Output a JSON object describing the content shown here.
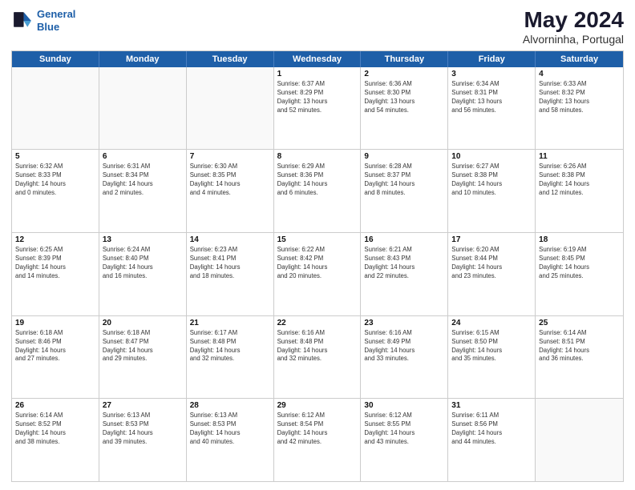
{
  "header": {
    "logo_line1": "General",
    "logo_line2": "Blue",
    "title": "May 2024",
    "subtitle": "Alvorninha, Portugal"
  },
  "calendar": {
    "days_of_week": [
      "Sunday",
      "Monday",
      "Tuesday",
      "Wednesday",
      "Thursday",
      "Friday",
      "Saturday"
    ],
    "rows": [
      [
        {
          "day": "",
          "info": ""
        },
        {
          "day": "",
          "info": ""
        },
        {
          "day": "",
          "info": ""
        },
        {
          "day": "1",
          "info": "Sunrise: 6:37 AM\nSunset: 8:29 PM\nDaylight: 13 hours\nand 52 minutes."
        },
        {
          "day": "2",
          "info": "Sunrise: 6:36 AM\nSunset: 8:30 PM\nDaylight: 13 hours\nand 54 minutes."
        },
        {
          "day": "3",
          "info": "Sunrise: 6:34 AM\nSunset: 8:31 PM\nDaylight: 13 hours\nand 56 minutes."
        },
        {
          "day": "4",
          "info": "Sunrise: 6:33 AM\nSunset: 8:32 PM\nDaylight: 13 hours\nand 58 minutes."
        }
      ],
      [
        {
          "day": "5",
          "info": "Sunrise: 6:32 AM\nSunset: 8:33 PM\nDaylight: 14 hours\nand 0 minutes."
        },
        {
          "day": "6",
          "info": "Sunrise: 6:31 AM\nSunset: 8:34 PM\nDaylight: 14 hours\nand 2 minutes."
        },
        {
          "day": "7",
          "info": "Sunrise: 6:30 AM\nSunset: 8:35 PM\nDaylight: 14 hours\nand 4 minutes."
        },
        {
          "day": "8",
          "info": "Sunrise: 6:29 AM\nSunset: 8:36 PM\nDaylight: 14 hours\nand 6 minutes."
        },
        {
          "day": "9",
          "info": "Sunrise: 6:28 AM\nSunset: 8:37 PM\nDaylight: 14 hours\nand 8 minutes."
        },
        {
          "day": "10",
          "info": "Sunrise: 6:27 AM\nSunset: 8:38 PM\nDaylight: 14 hours\nand 10 minutes."
        },
        {
          "day": "11",
          "info": "Sunrise: 6:26 AM\nSunset: 8:38 PM\nDaylight: 14 hours\nand 12 minutes."
        }
      ],
      [
        {
          "day": "12",
          "info": "Sunrise: 6:25 AM\nSunset: 8:39 PM\nDaylight: 14 hours\nand 14 minutes."
        },
        {
          "day": "13",
          "info": "Sunrise: 6:24 AM\nSunset: 8:40 PM\nDaylight: 14 hours\nand 16 minutes."
        },
        {
          "day": "14",
          "info": "Sunrise: 6:23 AM\nSunset: 8:41 PM\nDaylight: 14 hours\nand 18 minutes."
        },
        {
          "day": "15",
          "info": "Sunrise: 6:22 AM\nSunset: 8:42 PM\nDaylight: 14 hours\nand 20 minutes."
        },
        {
          "day": "16",
          "info": "Sunrise: 6:21 AM\nSunset: 8:43 PM\nDaylight: 14 hours\nand 22 minutes."
        },
        {
          "day": "17",
          "info": "Sunrise: 6:20 AM\nSunset: 8:44 PM\nDaylight: 14 hours\nand 23 minutes."
        },
        {
          "day": "18",
          "info": "Sunrise: 6:19 AM\nSunset: 8:45 PM\nDaylight: 14 hours\nand 25 minutes."
        }
      ],
      [
        {
          "day": "19",
          "info": "Sunrise: 6:18 AM\nSunset: 8:46 PM\nDaylight: 14 hours\nand 27 minutes."
        },
        {
          "day": "20",
          "info": "Sunrise: 6:18 AM\nSunset: 8:47 PM\nDaylight: 14 hours\nand 29 minutes."
        },
        {
          "day": "21",
          "info": "Sunrise: 6:17 AM\nSunset: 8:48 PM\nDaylight: 14 hours\nand 32 minutes."
        },
        {
          "day": "22",
          "info": "Sunrise: 6:16 AM\nSunset: 8:48 PM\nDaylight: 14 hours\nand 32 minutes."
        },
        {
          "day": "23",
          "info": "Sunrise: 6:16 AM\nSunset: 8:49 PM\nDaylight: 14 hours\nand 33 minutes."
        },
        {
          "day": "24",
          "info": "Sunrise: 6:15 AM\nSunset: 8:50 PM\nDaylight: 14 hours\nand 35 minutes."
        },
        {
          "day": "25",
          "info": "Sunrise: 6:14 AM\nSunset: 8:51 PM\nDaylight: 14 hours\nand 36 minutes."
        }
      ],
      [
        {
          "day": "26",
          "info": "Sunrise: 6:14 AM\nSunset: 8:52 PM\nDaylight: 14 hours\nand 38 minutes."
        },
        {
          "day": "27",
          "info": "Sunrise: 6:13 AM\nSunset: 8:53 PM\nDaylight: 14 hours\nand 39 minutes."
        },
        {
          "day": "28",
          "info": "Sunrise: 6:13 AM\nSunset: 8:53 PM\nDaylight: 14 hours\nand 40 minutes."
        },
        {
          "day": "29",
          "info": "Sunrise: 6:12 AM\nSunset: 8:54 PM\nDaylight: 14 hours\nand 42 minutes."
        },
        {
          "day": "30",
          "info": "Sunrise: 6:12 AM\nSunset: 8:55 PM\nDaylight: 14 hours\nand 43 minutes."
        },
        {
          "day": "31",
          "info": "Sunrise: 6:11 AM\nSunset: 8:56 PM\nDaylight: 14 hours\nand 44 minutes."
        },
        {
          "day": "",
          "info": ""
        }
      ]
    ]
  }
}
